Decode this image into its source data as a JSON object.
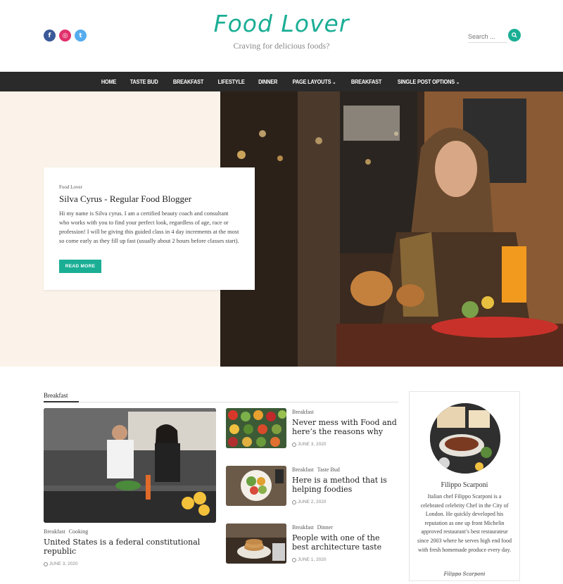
{
  "header": {
    "site_title": "Food Lover",
    "tagline": "Craving for delicious foods?",
    "search_placeholder": "Search ...",
    "social": [
      {
        "icon": "facebook-icon",
        "glyph": "f",
        "color": "#3b5998"
      },
      {
        "icon": "instagram-icon",
        "glyph": "◎",
        "color": "#e1306c"
      },
      {
        "icon": "twitter-icon",
        "glyph": "t",
        "color": "#55acee"
      }
    ]
  },
  "nav": {
    "items": [
      "HOME",
      "TASTE BUD",
      "BREAKFAST",
      "LIFESTYLE",
      "DINNER",
      "PAGE LAYOUTS",
      "BREAKFAST",
      "SINGLE POST OPTIONS"
    ],
    "caret_glyph": "⌄"
  },
  "hero": {
    "category": "Food Lover",
    "title": "Silva Cyrus - Regular Food Blogger",
    "text": "Hi my name is Silva cyrus. I am a certified beauty coach and consultant who works with you to find your perfect look, regardless of age, race or profession! I will be giving this guided class in 4 day increments at the most so come early as they fill up fast (usually about 2 hours before classes start).",
    "button": "READ MORE"
  },
  "section": {
    "label": "Breakfast"
  },
  "featured_post": {
    "categories": [
      "Breakfast",
      "Cooking"
    ],
    "title": "United States is a federal constitutional republic",
    "date": "JUNE 3, 2020"
  },
  "posts": [
    {
      "categories": [
        "Breakfast"
      ],
      "title": "Never mess with Food and here’s the reasons why",
      "date": "JUNE 3, 2020"
    },
    {
      "categories": [
        "Breakfast",
        "Taste Bud"
      ],
      "title": "Here is a method that is helping foodies",
      "date": "JUNE 2, 2020"
    },
    {
      "categories": [
        "Breakfast",
        "Dinner"
      ],
      "title": "People with one of the best architecture taste",
      "date": "JUNE 1, 2020"
    }
  ],
  "sidebar": {
    "name": "Filippo Scarponi",
    "bio": "Italian chef Filippo Scarponi is a celebrated celebrity Chef in the City of London. He quickly developed his reputation as one up front Michelin approved restaurant’s best restaurateur since 2003 where he serves high end food with fresh homemade produce every day.",
    "signature": "Filippo Scarponi"
  },
  "colors": {
    "accent": "#1aae95",
    "nav_bg": "#2a2a2a",
    "hero_bg": "#fbf3e9"
  }
}
